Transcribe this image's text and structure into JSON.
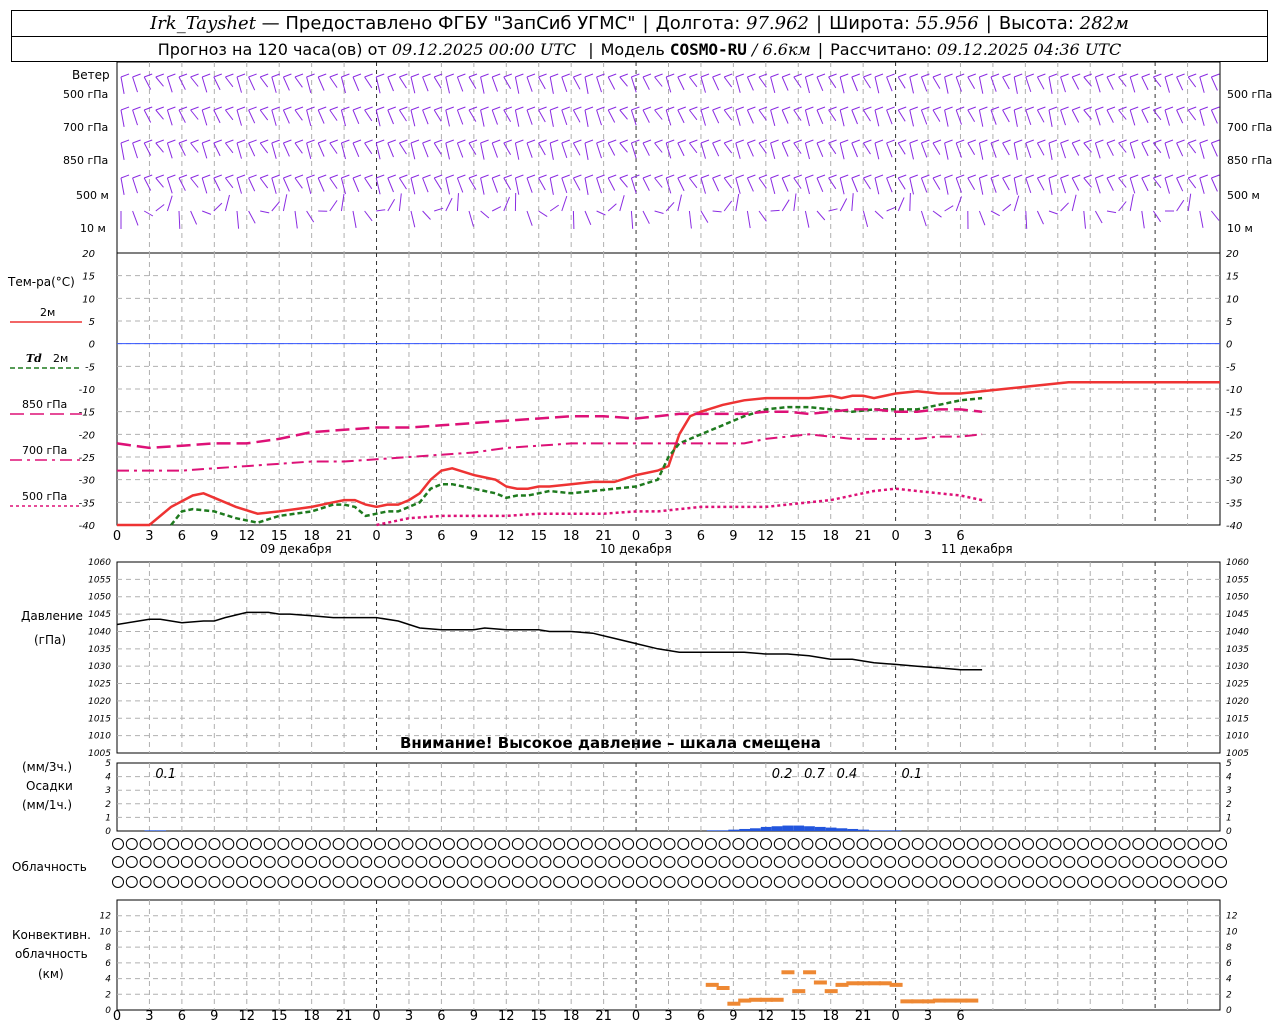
{
  "header": {
    "station": "Irk_Tayshet",
    "provider": "— Предоставлено ФГБУ \"ЗапСиб УГМС\"",
    "lon_label": "Долгота:",
    "lon_value": "97.962",
    "lat_label": "Широта:",
    "lat_value": "55.956",
    "alt_label": "Высота:",
    "alt_value": "282м",
    "forecast_label": "Прогноз на 120 часа(ов) от",
    "forecast_start": "09.12.2025 00:00 UTC",
    "model_label": "Модель",
    "model_name": "COSMO-RU",
    "model_res": "/ 6.6км",
    "calc_label": "Рассчитано:",
    "calc_time": "09.12.2025 04:36 UTC"
  },
  "labels": {
    "wind": "Ветер",
    "lvl500": "500 гПа",
    "lvl700": "700 гПа",
    "lvl850": "850 гПа",
    "m500": "500 м",
    "m10": "10 м",
    "temp": "Тем-ра(°С)",
    "t2m": "2м",
    "td_a": "Td",
    "td_b": "2м",
    "l850": "850 гПа",
    "l700": "700 гПа",
    "l500": "500 гПа",
    "pressure": "Давление",
    "pressure_unit": "(гПа)",
    "prec1": "(мм/3ч.)",
    "prec2": "Осадки",
    "prec3": "(мм/1ч.)",
    "cloud": "Облачность",
    "conv1": "Конвективн.",
    "conv2": "облачность",
    "conv3": "(км)",
    "warning": "Внимание! Высокое давление – шкала смещена",
    "day1": "09 декабря",
    "day2": "10 декабря",
    "day3": "11 декабря"
  },
  "colors": {
    "wind": "#8a2be2",
    "t2m": "#ee3333",
    "td": "#1e7a1e",
    "l850": "#dd1177",
    "l700": "#dd1177",
    "l500": "#dd1177",
    "pressure": "#000000",
    "precip": "#2255dd",
    "conv": "#ee8833",
    "zero": "#3355ff",
    "grid": "#b0b0b0"
  },
  "chart_data": [
    {
      "type": "line",
      "panel": "temperature",
      "x_hours": [
        0,
        3,
        6,
        9,
        12,
        15,
        18,
        21,
        24,
        27,
        30,
        33,
        36,
        39,
        42,
        45,
        48,
        51,
        54,
        57,
        60,
        63,
        66,
        69,
        72,
        75,
        78,
        81,
        84,
        87,
        90,
        93,
        96,
        99,
        102
      ],
      "x_ticks": [
        "0",
        "3",
        "6",
        "9",
        "12",
        "15",
        "18",
        "21",
        "0",
        "3",
        "6",
        "9",
        "12",
        "15",
        "18",
        "21",
        "0",
        "3",
        "6",
        "9",
        "12",
        "15",
        "18",
        "21",
        "0",
        "3",
        "6"
      ],
      "ylim": [
        -40,
        20
      ],
      "yticks": [
        -40,
        -35,
        -30,
        -25,
        -20,
        -15,
        -10,
        -5,
        0,
        5,
        10,
        15,
        20
      ],
      "series": [
        {
          "name": "2м",
          "x": [
            0,
            3,
            5,
            7,
            8,
            9,
            11,
            13,
            15,
            18,
            20,
            21,
            22,
            23,
            24,
            25,
            26,
            27,
            28,
            29,
            30,
            31,
            33,
            34,
            35,
            36,
            37,
            38,
            39,
            40,
            42,
            44,
            46,
            48,
            50,
            51,
            52,
            53,
            54,
            56,
            58,
            60,
            62,
            64,
            66,
            67,
            68,
            69,
            70,
            72,
            74,
            76,
            78,
            80,
            82,
            84,
            86,
            88,
            90,
            92,
            94,
            96,
            98,
            100,
            102
          ],
          "y": [
            -40,
            -40,
            -36,
            -33.5,
            -33,
            -34,
            -36,
            -37.5,
            -37,
            -36,
            -35,
            -34.5,
            -34.5,
            -35.5,
            -36,
            -35.5,
            -35.5,
            -34.5,
            -33,
            -30,
            -28,
            -27.5,
            -29,
            -29.5,
            -30,
            -31.5,
            -32,
            -32,
            -31.5,
            -31.5,
            -31,
            -30.5,
            -30.5,
            -29,
            -28,
            -27,
            -20,
            -16,
            -15,
            -13.5,
            -12.5,
            -12,
            -12,
            -12,
            -11.5,
            -12,
            -11.5,
            -11.5,
            -12,
            -11,
            -10.5,
            -11,
            -11,
            -10.5,
            -10,
            -9.5,
            -9,
            -8.5,
            -8.5,
            -8.5,
            -8.5,
            -8.5,
            -8.5,
            -8.5,
            -8.5
          ]
        },
        {
          "name": "Td 2м",
          "x": [
            5,
            6,
            7,
            9,
            11,
            13,
            15,
            18,
            20,
            21,
            22,
            23,
            24,
            25,
            26,
            27,
            28,
            29,
            30,
            31,
            33,
            34,
            35,
            36,
            37,
            38,
            39,
            40,
            42,
            44,
            46,
            48,
            50,
            51,
            52,
            53,
            54,
            56,
            58,
            60,
            62,
            64,
            66,
            68,
            70,
            72,
            74,
            76,
            78,
            80
          ],
          "y": [
            -40,
            -37,
            -36.5,
            -37,
            -38.5,
            -39.5,
            -38,
            -37,
            -35.5,
            -35.5,
            -36,
            -38,
            -37.5,
            -37,
            -37,
            -36,
            -35,
            -32,
            -31,
            -31,
            -32,
            -32.5,
            -33,
            -34,
            -33.5,
            -33.5,
            -33,
            -32.5,
            -33,
            -32.5,
            -32,
            -31.5,
            -30,
            -25,
            -22,
            -21,
            -20,
            -18,
            -16,
            -14.5,
            -14,
            -14,
            -14.5,
            -15,
            -14.5,
            -14.5,
            -14.5,
            -13.5,
            -12.5,
            -12
          ]
        },
        {
          "name": "850 гПа",
          "x": [
            0,
            3,
            6,
            9,
            12,
            15,
            18,
            21,
            24,
            27,
            30,
            33,
            36,
            39,
            42,
            45,
            48,
            50,
            52,
            54,
            56,
            58,
            60,
            62,
            64,
            66,
            68,
            70,
            72,
            74,
            76,
            78,
            80
          ],
          "y": [
            -22,
            -23,
            -22.5,
            -22,
            -22,
            -21,
            -19.5,
            -19,
            -18.5,
            -18.5,
            -18,
            -17.5,
            -17,
            -16.5,
            -16,
            -16,
            -16.5,
            -16,
            -15.5,
            -15.5,
            -15.5,
            -15.5,
            -15,
            -15,
            -15.5,
            -15,
            -14.5,
            -14.5,
            -15,
            -15,
            -14.5,
            -14.5,
            -15
          ]
        },
        {
          "name": "700 гПа",
          "x": [
            0,
            3,
            6,
            9,
            12,
            15,
            18,
            21,
            24,
            27,
            30,
            33,
            36,
            39,
            42,
            45,
            48,
            50,
            52,
            54,
            56,
            58,
            60,
            62,
            64,
            66,
            68,
            70,
            72,
            74,
            76,
            78,
            80
          ],
          "y": [
            -28,
            -28,
            -28,
            -27.5,
            -27,
            -26.5,
            -26,
            -26,
            -25.5,
            -25,
            -24.5,
            -24,
            -23,
            -22.5,
            -22,
            -22,
            -22,
            -22,
            -22,
            -22,
            -22,
            -22,
            -21,
            -20.5,
            -20,
            -20.5,
            -21,
            -21,
            -21,
            -21,
            -20.5,
            -20.5,
            -20
          ]
        },
        {
          "name": "500 гПа",
          "x": [
            24,
            27,
            30,
            33,
            36,
            39,
            42,
            45,
            48,
            50,
            52,
            54,
            56,
            58,
            60,
            62,
            64,
            66,
            68,
            70,
            72,
            74,
            76,
            78,
            80
          ],
          "y": [
            -40,
            -38.5,
            -38,
            -38,
            -38,
            -37.5,
            -37.5,
            -37.5,
            -37,
            -37,
            -36.5,
            -36,
            -36,
            -36,
            -36,
            -35.5,
            -35,
            -34.5,
            -33.5,
            -32.5,
            -32,
            -32.5,
            -33,
            -33.5,
            -34.5
          ]
        }
      ]
    },
    {
      "type": "line",
      "panel": "pressure",
      "ylabel": "Давление (гПа)",
      "ylim": [
        1005,
        1060
      ],
      "yticks": [
        1005,
        1010,
        1015,
        1020,
        1025,
        1030,
        1035,
        1040,
        1045,
        1050,
        1055,
        1060
      ],
      "x": [
        0,
        2,
        3,
        4,
        6,
        8,
        9,
        10,
        12,
        14,
        15,
        16,
        18,
        20,
        21,
        22,
        24,
        26,
        27,
        28,
        30,
        32,
        33,
        34,
        36,
        38,
        39,
        40,
        42,
        44,
        46,
        48,
        50,
        52,
        54,
        56,
        58,
        60,
        62,
        64,
        66,
        68,
        70,
        72,
        74,
        76,
        78,
        80
      ],
      "y": [
        1042,
        1043,
        1043.5,
        1043.5,
        1042.5,
        1043,
        1043,
        1044,
        1045.5,
        1045.5,
        1045,
        1045,
        1044.5,
        1044,
        1044,
        1044,
        1044,
        1043,
        1042,
        1041,
        1040.5,
        1040.5,
        1040.5,
        1041,
        1040.5,
        1040.5,
        1040.5,
        1040,
        1040,
        1039.5,
        1038,
        1036.5,
        1035,
        1034,
        1034,
        1034,
        1034,
        1033.5,
        1033.5,
        1033,
        1032,
        1032,
        1031,
        1030.5,
        1030,
        1029.5,
        1029,
        1029
      ]
    },
    {
      "type": "bar",
      "panel": "precipitation",
      "ylim": [
        0,
        5
      ],
      "yticks": [
        0,
        1,
        2,
        3,
        4,
        5
      ],
      "labels_3h": [
        {
          "hour": 4.5,
          "text": "0.1"
        },
        {
          "hour": 61.5,
          "text": "0.2"
        },
        {
          "hour": 64.5,
          "text": "0.7"
        },
        {
          "hour": 67.5,
          "text": "0.4"
        },
        {
          "hour": 73.5,
          "text": "0.1"
        }
      ],
      "x": [
        3,
        4,
        55,
        56,
        57,
        58,
        59,
        60,
        61,
        62,
        63,
        64,
        65,
        66,
        67,
        68,
        69,
        70,
        71,
        72
      ],
      "values": [
        0.05,
        0.05,
        0.05,
        0.05,
        0.1,
        0.15,
        0.2,
        0.3,
        0.35,
        0.4,
        0.4,
        0.35,
        0.3,
        0.25,
        0.2,
        0.15,
        0.1,
        0.05,
        0.05,
        0.05
      ]
    },
    {
      "type": "bar",
      "panel": "convective_cloud",
      "ylabel": "(км)",
      "ylim": [
        0,
        14
      ],
      "yticks": [
        0,
        2,
        4,
        6,
        8,
        10,
        12
      ],
      "x": [
        55,
        56,
        57,
        58,
        59,
        60,
        61,
        62,
        63,
        64,
        65,
        66,
        67,
        68,
        69,
        70,
        71,
        72,
        73,
        74,
        75,
        76,
        77,
        78,
        79
      ],
      "values": [
        3.2,
        2.8,
        0.8,
        1.2,
        1.3,
        1.3,
        1.3,
        4.8,
        2.4,
        4.8,
        3.5,
        2.4,
        3.2,
        3.4,
        3.4,
        3.4,
        3.4,
        3.2,
        1.1,
        1.1,
        1.1,
        1.2,
        1.2,
        1.2,
        1.2
      ]
    },
    {
      "type": "table",
      "panel": "cloudiness_octas",
      "rows": 3,
      "row_upper": [
        0,
        0,
        0,
        0,
        0,
        0,
        0,
        0,
        0,
        0,
        0,
        0,
        0,
        0,
        0,
        0,
        0,
        0,
        0,
        0,
        0,
        0,
        0,
        0,
        0,
        0,
        0,
        0,
        0,
        0,
        0,
        0,
        0,
        0,
        0,
        0,
        0,
        0,
        0,
        0,
        0,
        0,
        0,
        0,
        0,
        0,
        0,
        0,
        0,
        0,
        0,
        0,
        0,
        0,
        0,
        0,
        0,
        0,
        0,
        0,
        0,
        0,
        0,
        0,
        0,
        0,
        0,
        0,
        0,
        0,
        0,
        0,
        0,
        0,
        0,
        0,
        0,
        0,
        0,
        0,
        0
      ],
      "row_middle": [
        0,
        0,
        0,
        0,
        0,
        0,
        0,
        0,
        0,
        0,
        0,
        0,
        0,
        0,
        0,
        0,
        0,
        0,
        0,
        0,
        0,
        0,
        0,
        0,
        0,
        0,
        0,
        0,
        0,
        0,
        0,
        0,
        0,
        0,
        0,
        0,
        0,
        0,
        0,
        0,
        0,
        0,
        0,
        0,
        0,
        0,
        0,
        0,
        0,
        0,
        0,
        0,
        0,
        0,
        0,
        0,
        0,
        0,
        0,
        0,
        0,
        0,
        0,
        0,
        0,
        0,
        0,
        0,
        0,
        0,
        0,
        0,
        0,
        0,
        0,
        0,
        0,
        0,
        0,
        0,
        0
      ],
      "row_lower": [
        0,
        0,
        0,
        0,
        0,
        0,
        0,
        0,
        0,
        0,
        0,
        0,
        0,
        0,
        0,
        0,
        0,
        0,
        0,
        0,
        0,
        0,
        0,
        0,
        0,
        0,
        0,
        0,
        0,
        0,
        0,
        0,
        0,
        0,
        0,
        0,
        0,
        0,
        0,
        0,
        0,
        0,
        0,
        0,
        0,
        0,
        0,
        0,
        0,
        0,
        0,
        0,
        0,
        0,
        0,
        0,
        0,
        0,
        0,
        0,
        0,
        0,
        0,
        0,
        0,
        0,
        0,
        0,
        0,
        0,
        0,
        0,
        0,
        0,
        0,
        0,
        0,
        0,
        0,
        0,
        0
      ]
    }
  ]
}
